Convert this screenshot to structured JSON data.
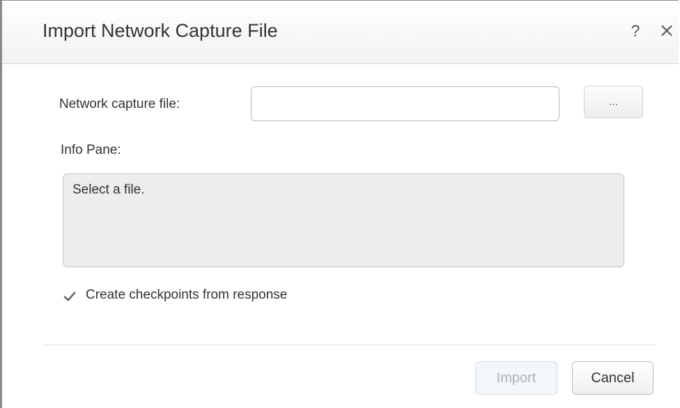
{
  "dialog": {
    "title": "Import Network Capture File",
    "help_label": "?",
    "close_icon": "close-icon"
  },
  "form": {
    "file_label": "Network capture file:",
    "file_value": "",
    "browse_label": "...",
    "info_label": "Info Pane:",
    "info_text": "Select a file.",
    "checkbox_label": "Create checkpoints from response",
    "checkbox_checked": true
  },
  "footer": {
    "import_label": "Import",
    "import_enabled": false,
    "cancel_label": "Cancel"
  },
  "colors": {
    "title_text": "#333333",
    "info_pane_bg": "#ededed",
    "disabled_text": "#a9b2bb"
  }
}
